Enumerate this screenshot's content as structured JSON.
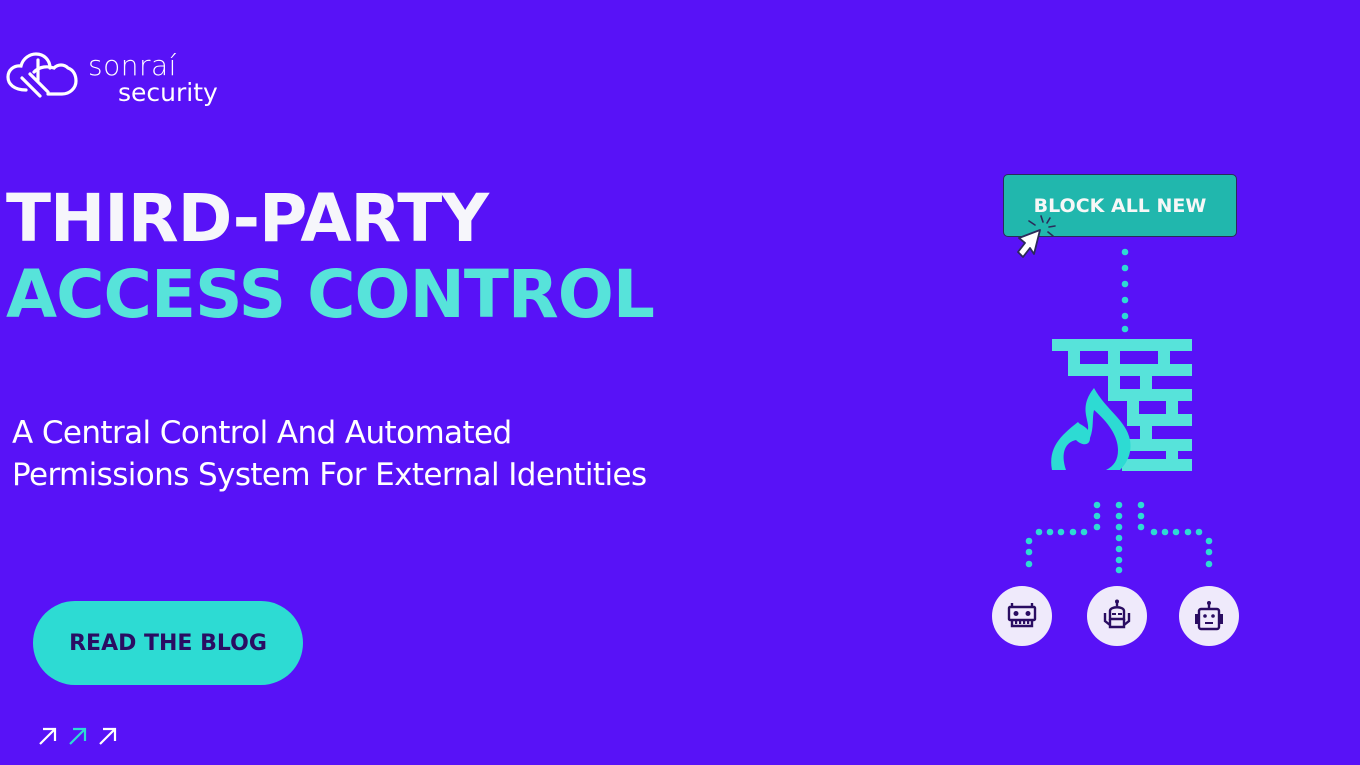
{
  "brand": {
    "name_line1": "sonraí",
    "name_line2": "security",
    "logo_icon": "cloud-link-icon"
  },
  "headline": {
    "line1": "THIRD-PARTY",
    "line2": "ACCESS CONTROL"
  },
  "subtitle": {
    "line1": "A Central Control And Automated",
    "line2": "Permissions System For External Identities"
  },
  "cta": {
    "label": "READ THE BLOG"
  },
  "decorative_arrows": [
    "arrow-up-right-icon",
    "arrow-up-right-icon",
    "arrow-up-right-icon"
  ],
  "illustration": {
    "block_button_label": "BLOCK ALL NEW",
    "cursor_icon": "click-cursor-icon",
    "firewall_icon": "firewall-icon",
    "identities": [
      {
        "icon": "robot-icon-1"
      },
      {
        "icon": "robot-icon-2"
      },
      {
        "icon": "robot-icon-3"
      }
    ]
  },
  "colors": {
    "background": "#5812f7",
    "accent_teal": "#57e3da",
    "cta_teal": "#2ddbd3",
    "button_teal": "#21b7ad",
    "dark_text": "#2a0d62",
    "robot_bg": "#efeafb"
  }
}
